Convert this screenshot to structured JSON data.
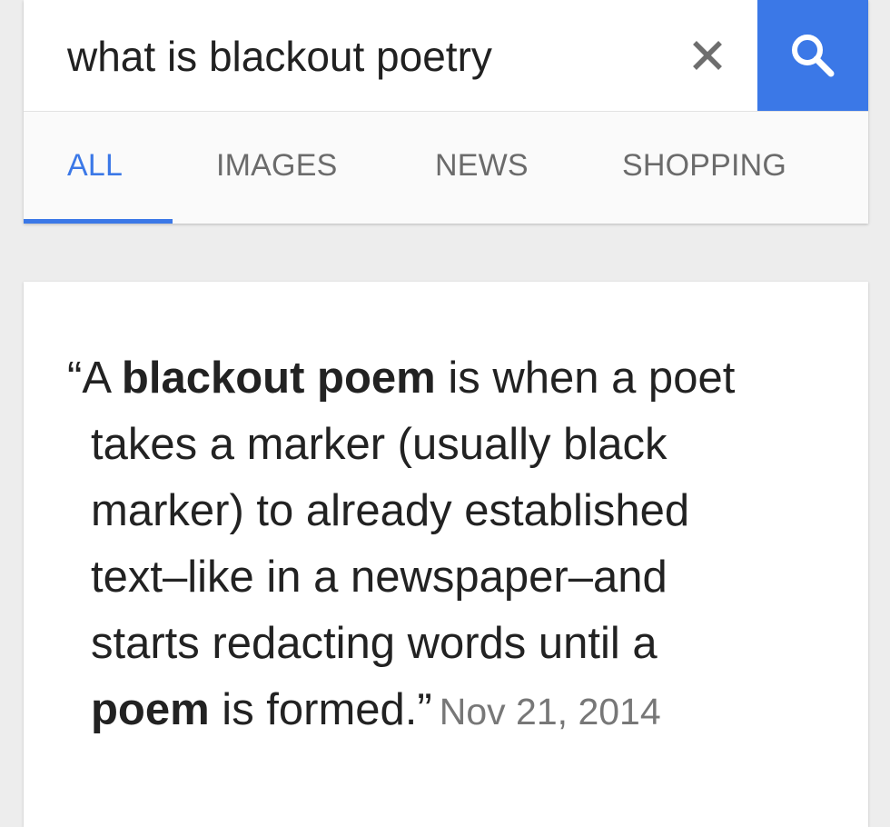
{
  "search": {
    "query": "what is blackout poetry",
    "clear_icon": "close-icon",
    "submit_icon": "search-icon"
  },
  "tabs": [
    {
      "label": "ALL",
      "active": true
    },
    {
      "label": "IMAGES",
      "active": false
    },
    {
      "label": "NEWS",
      "active": false
    },
    {
      "label": "SHOPPING",
      "active": false
    }
  ],
  "colors": {
    "accent": "#3b78e7",
    "tab_inactive": "#6b6b6b",
    "page_background": "#ededed"
  },
  "featured_snippet": {
    "line1": {
      "open_quote": "“A ",
      "bold": "blackout poem",
      "rest": " is when a poet"
    },
    "line2": "takes a marker (usually black",
    "line3": "marker) to already established",
    "line4": "text–like in a newspaper–and",
    "line5": "starts redacting words until a",
    "line6": {
      "bold": "poem",
      "rest": " is formed.”"
    },
    "date": "Nov 21, 2014"
  }
}
